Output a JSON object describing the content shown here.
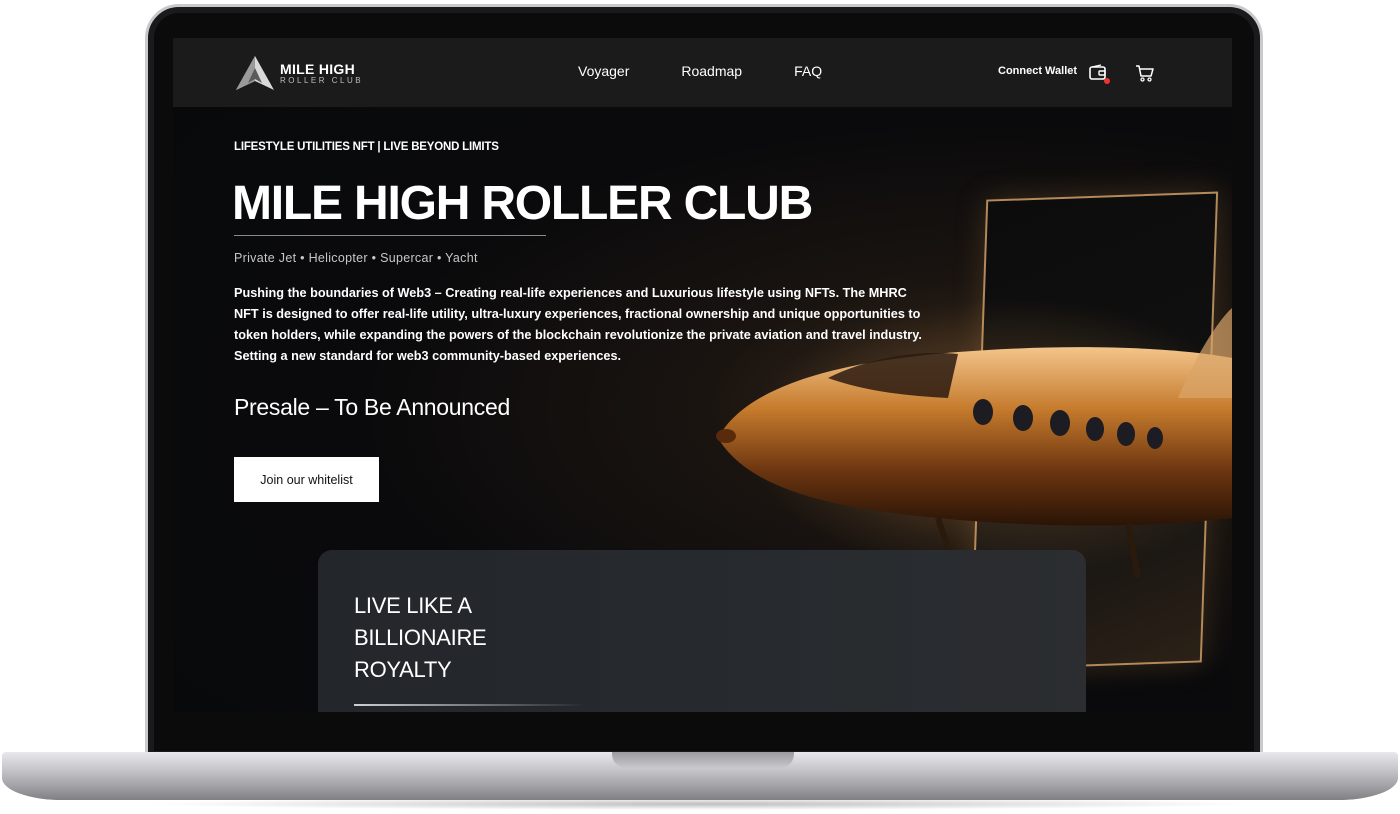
{
  "nav": {
    "brand_main": "MILE HIGH",
    "brand_sub": "ROLLER CLUB",
    "links": [
      "Voyager",
      "Roadmap",
      "FAQ"
    ],
    "connect_wallet": "Connect Wallet",
    "icons": [
      "wallet-icon",
      "cart-icon"
    ]
  },
  "hero": {
    "kicker": "LIFESTYLE UTILITIES NFT | LIVE BEYOND LIMITS",
    "title": "MILE HIGH ROLLER CLUB",
    "categories": "Private Jet  •  Helicopter  •  Supercar  •  Yacht",
    "intro": "Pushing the boundaries of Web3 – Creating real-life experiences and Luxurious lifestyle using NFTs. The MHRC NFT is designed to offer real-life utility, ultra-luxury experiences, fractional ownership and unique opportunities to token holders, while expanding the powers of the blockchain revolutionize the private aviation and travel industry. Setting a new standard for web3 community-based experiences.",
    "presale": "Presale – To Be Announced",
    "cta": "Join our whitelist"
  },
  "card": {
    "title_lines": [
      "LIVE LIKE A",
      "BILLIONAIRE",
      "ROYALTY"
    ]
  },
  "colors": {
    "nav_bg": "#1b1b1c",
    "accent_gold": "#b48a5a",
    "notification_dot": "#e33333"
  }
}
